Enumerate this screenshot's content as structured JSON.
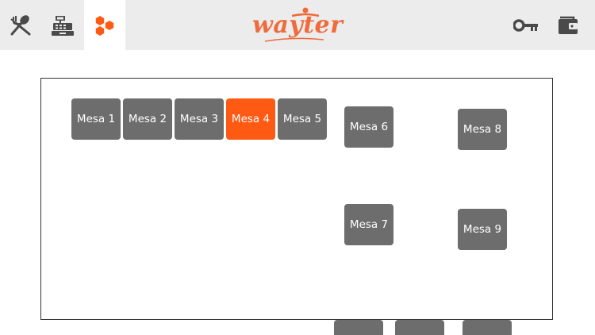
{
  "app": {
    "logo_text": "wayter",
    "accent_color": "#ef6b3b",
    "selected_color": "#ff5a14",
    "table_color": "#6d6d6d"
  },
  "nav": {
    "items": [
      {
        "name": "menu",
        "icon": "fork-spoon-icon"
      },
      {
        "name": "cashier",
        "icon": "cash-register-icon"
      },
      {
        "name": "tables",
        "icon": "hexagons-icon",
        "active": true
      }
    ],
    "right_items": [
      {
        "name": "login",
        "icon": "key-icon"
      },
      {
        "name": "wallet",
        "icon": "wallet-icon"
      }
    ]
  },
  "floor": {
    "tables": [
      {
        "label": "Mesa 1",
        "selected": false
      },
      {
        "label": "Mesa 2",
        "selected": false
      },
      {
        "label": "Mesa 3",
        "selected": false
      },
      {
        "label": "Mesa 4",
        "selected": true
      },
      {
        "label": "Mesa 5",
        "selected": false
      },
      {
        "label": "Mesa 6",
        "selected": false
      },
      {
        "label": "Mesa 7",
        "selected": false
      },
      {
        "label": "Mesa 8",
        "selected": false
      },
      {
        "label": "Mesa 9",
        "selected": false
      }
    ]
  }
}
